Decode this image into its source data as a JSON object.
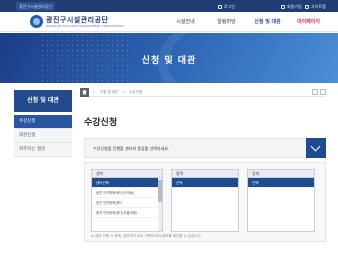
{
  "topbar": {
    "site_tag": "광진구시설관리공단",
    "login": "로그인",
    "join": "회원가입",
    "sitemap": "사이트맵"
  },
  "logo": {
    "name": "광진구시설관리공단",
    "sub": "GWANGJIN FACILITIES MANAGEMENT CORPORATION"
  },
  "gnb": {
    "items": [
      "시설안내",
      "알림마당",
      "신청 및 대관",
      "마이페이지"
    ]
  },
  "hero": {
    "title": "신청 및 대관"
  },
  "sidebar": {
    "title": "신청 및 대관",
    "items": [
      "수강신청",
      "대관신청",
      "자주하는 질문"
    ]
  },
  "breadcrumb": {
    "items": [
      "신청 및 대관",
      "수강신청"
    ]
  },
  "page": {
    "title": "수강신청"
  },
  "info": {
    "text": "수강신청을 진행할 센터와 종류를 선택하세요."
  },
  "selector": {
    "columns": [
      {
        "header": "센터",
        "options": [
          "센터선택",
          "광진구민체육센터(구의동)",
          "광진구민체육센터",
          "중곡구민체육센터(자율과정)"
        ],
        "selected": 0
      },
      {
        "header": "종목",
        "options": [
          "선택"
        ],
        "selected": 0
      },
      {
        "header": "강좌",
        "options": [
          "선택"
        ],
        "selected": 0
      }
    ],
    "note": "※ 센터 선택 시 종목, 강좌까지 모두 선택하셔야 정보를 확인할 수 있습니다."
  },
  "colors": {
    "primary": "#1e4c8f",
    "topbar": "#1f3c74",
    "accent_mypage": "#e0306a"
  }
}
